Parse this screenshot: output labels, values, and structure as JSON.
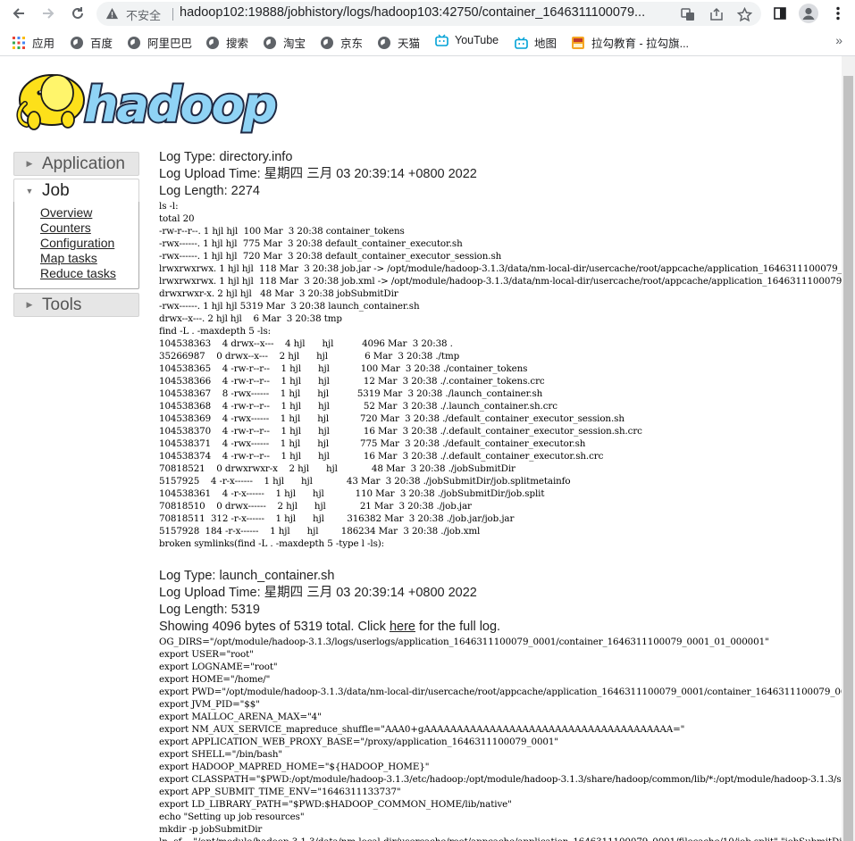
{
  "browser": {
    "insecure_label": "不安全",
    "url": "hadoop102:19888/jobhistory/logs/hadoop103:42750/container_1646311100079..."
  },
  "bookmarks": [
    {
      "label": "应用",
      "icon": "apps-grid-icon"
    },
    {
      "label": "百度",
      "icon": "globe-icon"
    },
    {
      "label": "阿里巴巴",
      "icon": "globe-icon"
    },
    {
      "label": "搜索",
      "icon": "globe-icon"
    },
    {
      "label": "淘宝",
      "icon": "globe-icon"
    },
    {
      "label": "京东",
      "icon": "globe-icon"
    },
    {
      "label": "天猫",
      "icon": "globe-icon"
    },
    {
      "label": "YouTube",
      "icon": "bilibili-tv-icon"
    },
    {
      "label": "地图",
      "icon": "bilibili-tv-icon"
    },
    {
      "label": "拉勾教育 - 拉勾旗...",
      "icon": "lagou-icon"
    }
  ],
  "nav": {
    "application_label": "Application",
    "job_label": "Job",
    "job_links": [
      "Overview",
      "Counters",
      "Configuration",
      "Map tasks",
      "Reduce tasks"
    ],
    "tools_label": "Tools"
  },
  "logs": [
    {
      "type_line": "Log Type: directory.info",
      "upload_line": "Log Upload Time: 星期四 三月 03 20:39:14 +0800 2022",
      "length_line": "Log Length: 2274",
      "body": "ls -l:\ntotal 20\n-rw-r--r--. 1 hjl hjl  100 Mar  3 20:38 container_tokens\n-rwx------. 1 hjl hjl  775 Mar  3 20:38 default_container_executor.sh\n-rwx------. 1 hjl hjl  720 Mar  3 20:38 default_container_executor_session.sh\nlrwxrwxrwx. 1 hjl hjl  118 Mar  3 20:38 job.jar -> /opt/module/hadoop-3.1.3/data/nm-local-dir/usercache/root/appcache/application_1646311100079_0001/filecache/12/job.jar\nlrwxrwxrwx. 1 hjl hjl  118 Mar  3 20:38 job.xml -> /opt/module/hadoop-3.1.3/data/nm-local-dir/usercache/root/appcache/application_1646311100079_0001/filecache/13/job.xml\ndrwxrwxr-x. 2 hjl hjl   48 Mar  3 20:38 jobSubmitDir\n-rwx------. 1 hjl hjl 5319 Mar  3 20:38 launch_container.sh\ndrwx--x---. 2 hjl hjl    6 Mar  3 20:38 tmp\nfind -L . -maxdepth 5 -ls:\n104538363    4 drwx--x---    4 hjl      hjl          4096 Mar  3 20:38 .\n35266987    0 drwx--x---    2 hjl      hjl             6 Mar  3 20:38 ./tmp\n104538365    4 -rw-r--r--    1 hjl      hjl           100 Mar  3 20:38 ./container_tokens\n104538366    4 -rw-r--r--    1 hjl      hjl            12 Mar  3 20:38 ./.container_tokens.crc\n104538367    8 -rwx------    1 hjl      hjl          5319 Mar  3 20:38 ./launch_container.sh\n104538368    4 -rw-r--r--    1 hjl      hjl            52 Mar  3 20:38 ./.launch_container.sh.crc\n104538369    4 -rwx------    1 hjl      hjl           720 Mar  3 20:38 ./default_container_executor_session.sh\n104538370    4 -rw-r--r--    1 hjl      hjl            16 Mar  3 20:38 ./.default_container_executor_session.sh.crc\n104538371    4 -rwx------    1 hjl      hjl           775 Mar  3 20:38 ./default_container_executor.sh\n104538374    4 -rw-r--r--    1 hjl      hjl            16 Mar  3 20:38 ./.default_container_executor.sh.crc\n70818521    0 drwxrwxr-x    2 hjl      hjl            48 Mar  3 20:38 ./jobSubmitDir\n5157925    4 -r-x------    1 hjl      hjl            43 Mar  3 20:38 ./jobSubmitDir/job.splitmetainfo\n104538361    4 -r-x------    1 hjl      hjl           110 Mar  3 20:38 ./jobSubmitDir/job.split\n70818510    0 drwx------    2 hjl      hjl            21 Mar  3 20:38 ./job.jar\n70818511  312 -r-x------    1 hjl      hjl        316382 Mar  3 20:38 ./job.jar/job.jar\n5157928  184 -r-x------    1 hjl      hjl        186234 Mar  3 20:38 ./job.xml\nbroken symlinks(find -L . -maxdepth 5 -type l -ls):"
    },
    {
      "type_line": "Log Type: launch_container.sh",
      "upload_line": "Log Upload Time: 星期四 三月 03 20:39:14 +0800 2022",
      "length_line": "Log Length: 5319",
      "showing_prefix": "Showing 4096 bytes of 5319 total. Click ",
      "showing_link": "here",
      "showing_suffix": " for the full log.",
      "body": "OG_DIRS=\"/opt/module/hadoop-3.1.3/logs/userlogs/application_1646311100079_0001/container_1646311100079_0001_01_000001\"\nexport USER=\"root\"\nexport LOGNAME=\"root\"\nexport HOME=\"/home/\"\nexport PWD=\"/opt/module/hadoop-3.1.3/data/nm-local-dir/usercache/root/appcache/application_1646311100079_0001/container_1646311100079_0001_01_000001\"\nexport JVM_PID=\"$$\"\nexport MALLOC_ARENA_MAX=\"4\"\nexport NM_AUX_SERVICE_mapreduce_shuffle=\"AAA0+gAAAAAAAAAAAAAAAAAAAAAAAAAAAAAAAAAAAAAA=\"\nexport APPLICATION_WEB_PROXY_BASE=\"/proxy/application_1646311100079_0001\"\nexport SHELL=\"/bin/bash\"\nexport HADOOP_MAPRED_HOME=\"${HADOOP_HOME}\"\nexport CLASSPATH=\"$PWD:/opt/module/hadoop-3.1.3/etc/hadoop:/opt/module/hadoop-3.1.3/share/hadoop/common/lib/*:/opt/module/hadoop-3.1.3/share/hadoop/common/*\"\nexport APP_SUBMIT_TIME_ENV=\"1646311133737\"\nexport LD_LIBRARY_PATH=\"$PWD:$HADOOP_COMMON_HOME/lib/native\"\necho \"Setting up job resources\"\nmkdir -p jobSubmitDir\nln -sf -- \"/opt/module/hadoop-3.1.3/data/nm-local-dir/usercache/root/appcache/application_1646311100079_0001/filecache/10/job.split\" \"jobSubmitDir/job.split\""
    }
  ]
}
